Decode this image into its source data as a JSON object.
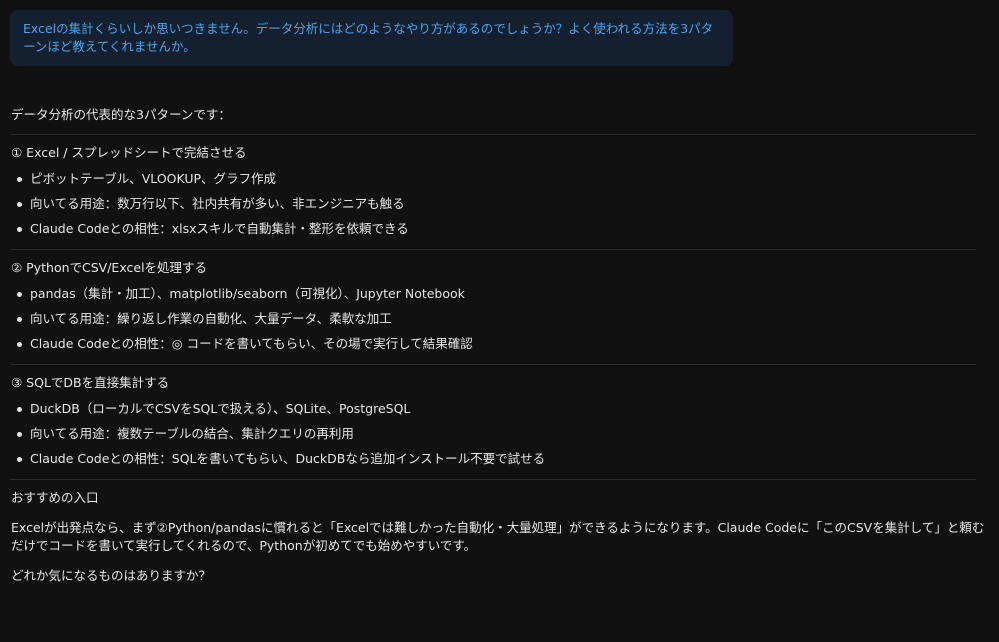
{
  "user_message": "Excelの集計くらいしか思いつきません。データ分析にはどのようなやり方があるのでしょうか？よく使われる方法を3パターンほど教えてくれませんか。",
  "assistant": {
    "intro": "データ分析の代表的な3パターンです：",
    "sections": [
      {
        "heading": "① Excel / スプレッドシートで完結させる",
        "bullets": [
          "ピボットテーブル、VLOOKUP、グラフ作成",
          "向いてる用途：数万行以下、社内共有が多い、非エンジニアも触る",
          "Claude Codeとの相性：xlsxスキルで自動集計・整形を依頼できる"
        ]
      },
      {
        "heading": "② PythonでCSV/Excelを処理する",
        "bullets": [
          "pandas（集計・加工）、matplotlib/seaborn（可視化）、Jupyter Notebook",
          "向いてる用途：繰り返し作業の自動化、大量データ、柔軟な加工",
          "Claude Codeとの相性：◎ コードを書いてもらい、その場で実行して結果確認"
        ]
      },
      {
        "heading": "③ SQLでDBを直接集計する",
        "bullets": [
          "DuckDB（ローカルでCSVをSQLで扱える）、SQLite、PostgreSQL",
          "向いてる用途：複数テーブルの結合、集計クエリの再利用",
          "Claude Codeとの相性：SQLを書いてもらい、DuckDBなら追加インストール不要で試せる"
        ]
      }
    ],
    "recommend_heading": "おすすめの入口",
    "recommend_body": "Excelが出発点なら、まず②Python/pandasに慣れると「Excelでは難しかった自動化・大量処理」ができるようになります。Claude Codeに「このCSVを集計して」と頼むだけでコードを書いて実行してくれるので、Pythonが初めてでも始めやすいです。",
    "question": "どれか気になるものはありますか？"
  },
  "colors": {
    "background": "#111111",
    "user_bubble": "#142030",
    "user_text": "#4aa3e8",
    "assistant_text": "#e6e6e6",
    "divider": "#2c2c2c"
  }
}
